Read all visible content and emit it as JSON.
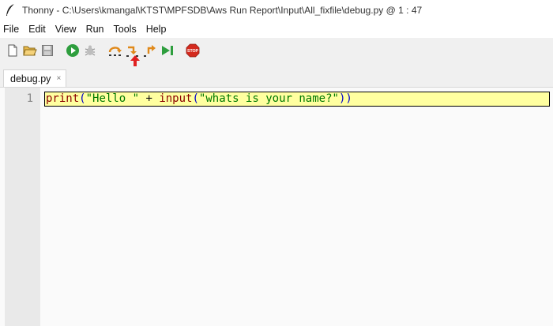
{
  "window": {
    "title": "Thonny  -  C:\\Users\\kmangal\\KTST\\MPFSDB\\Aws Run Report\\Input\\All_fixfile\\debug.py  @  1 : 47"
  },
  "menubar": {
    "items": [
      "File",
      "Edit",
      "View",
      "Run",
      "Tools",
      "Help"
    ]
  },
  "toolbar": {
    "buttons": [
      {
        "name": "new-file-icon"
      },
      {
        "name": "open-folder-icon"
      },
      {
        "name": "save-icon"
      },
      {
        "name": "run-icon"
      },
      {
        "name": "debug-icon"
      },
      {
        "name": "step-over-icon"
      },
      {
        "name": "step-into-icon"
      },
      {
        "name": "step-out-icon"
      },
      {
        "name": "resume-icon"
      },
      {
        "name": "stop-icon",
        "label": "STOP"
      }
    ],
    "colors": {
      "run": "#2e9e3e",
      "step": "#e0891a",
      "stop": "#d42a1e",
      "pointer": "#e02020"
    }
  },
  "tabs": [
    {
      "label": "debug.py",
      "close": "×"
    }
  ],
  "editor": {
    "line_number": "1",
    "tokens": [
      {
        "text": "print",
        "kind": "builtin"
      },
      {
        "text": "(",
        "kind": "paren"
      },
      {
        "text": "\"Hello \"",
        "kind": "string"
      },
      {
        "text": " + ",
        "kind": "op"
      },
      {
        "text": "input",
        "kind": "builtin"
      },
      {
        "text": "(",
        "kind": "paren"
      },
      {
        "text": "\"whats is your name?\"",
        "kind": "string"
      },
      {
        "text": "))",
        "kind": "paren"
      }
    ],
    "highlight_color": "#ffffa0"
  }
}
